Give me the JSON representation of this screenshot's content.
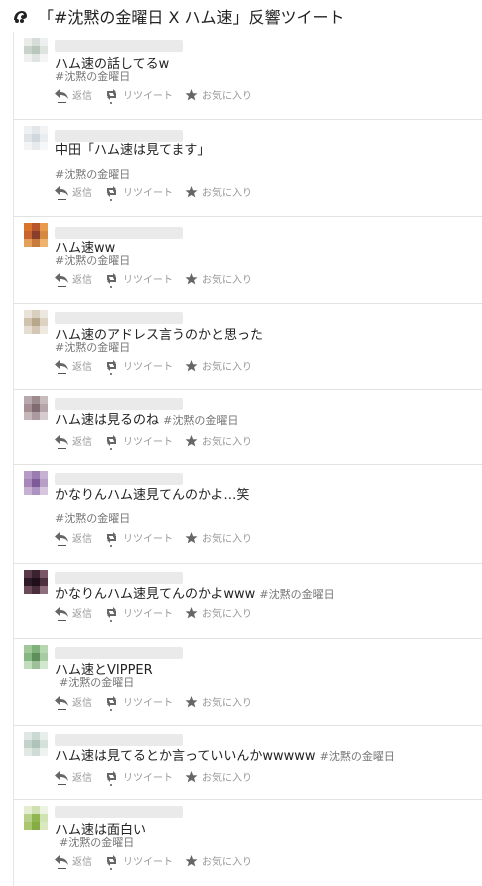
{
  "header": {
    "logo_icon": "eye-logo-icon",
    "title": "「#沈黙の金曜日 X ハム速」反響ツイート"
  },
  "actions": {
    "reply": "返信",
    "retweet": "リツイート",
    "favorite": "お気に入り"
  },
  "colors": {
    "action_gray": "#999999",
    "hashtag_gray": "#777777",
    "divider": "#e2e2e2"
  },
  "tweets": [
    {
      "text": "ハム速の話してるw",
      "hashtag": "#沈黙の金曜日"
    },
    {
      "text": "中田「ハム速は見てます」",
      "hashtag": "#沈黙の金曜日"
    },
    {
      "text": "ハム速ww",
      "hashtag": "#沈黙の金曜日"
    },
    {
      "text": "ハム速のアドレス言うのかと思った",
      "hashtag": "#沈黙の金曜日"
    },
    {
      "text": "ハム速は見るのね",
      "hashtag": "#沈黙の金曜日"
    },
    {
      "text": "かなりんハム速見てんのかよ…笑",
      "hashtag": "#沈黙の金曜日"
    },
    {
      "text": "かなりんハム速見てんのかよwww",
      "hashtag": "#沈黙の金曜日"
    },
    {
      "text": "ハム速とVIPPER",
      "hashtag": "#沈黙の金曜日"
    },
    {
      "text": "ハム速は見てるとか言っていいんかwwwww",
      "hashtag": "#沈黙の金曜日"
    },
    {
      "text": "ハム速は面白い",
      "hashtag": "#沈黙の金曜日"
    }
  ]
}
